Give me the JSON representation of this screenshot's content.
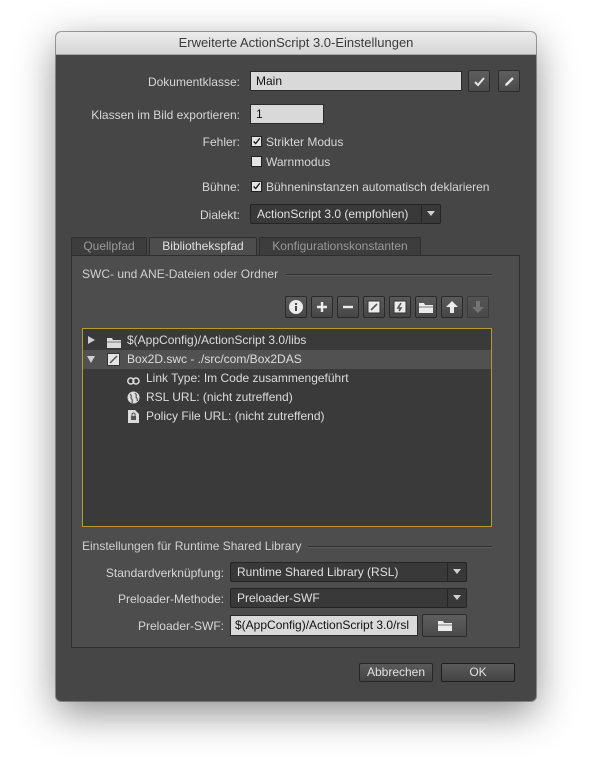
{
  "window": {
    "title": "Erweiterte ActionScript 3.0-Einstellungen"
  },
  "form": {
    "document_class_label": "Dokumentklasse:",
    "document_class_value": "Main",
    "export_frame_label": "Klassen im Bild exportieren:",
    "export_frame_value": "1",
    "errors_label": "Fehler:",
    "strict_mode_label": "Strikter Modus",
    "strict_mode_checked": true,
    "warnings_mode_label": "Warnmodus",
    "warnings_mode_checked": false,
    "stage_label": "Bühne:",
    "stage_auto_declare_label": "Bühneninstanzen automatisch deklarieren",
    "stage_auto_declare_checked": true,
    "dialect_label": "Dialekt:",
    "dialect_value": "ActionScript 3.0 (empfohlen)"
  },
  "tabs": [
    {
      "label": "Quellpfad",
      "active": false
    },
    {
      "label": "Bibliothekspfad",
      "active": true
    },
    {
      "label": "Konfigurationskonstanten",
      "active": false
    }
  ],
  "library": {
    "section_title": "SWC- und ANE-Dateien oder Ordner",
    "toolbar": [
      "info-icon",
      "add-icon",
      "remove-icon",
      "swc-file-icon",
      "flex-sdk-icon",
      "folder-icon",
      "arrow-up-icon",
      "arrow-down-icon"
    ],
    "tree": [
      {
        "label": "$(AppConfig)/ActionScript 3.0/libs",
        "expanded": false
      },
      {
        "label": "Box2D.swc - ./src/com/Box2DAS",
        "expanded": true
      },
      {
        "label": "Link Type: Im Code zusammengeführt"
      },
      {
        "label": "RSL URL: (nicht zutreffend)"
      },
      {
        "label": "Policy File URL: (nicht zutreffend)"
      }
    ]
  },
  "rsl": {
    "section_title": "Einstellungen für Runtime Shared Library",
    "default_linkage_label": "Standardverknüpfung:",
    "default_linkage_value": "Runtime Shared Library (RSL)",
    "preloader_method_label": "Preloader-Methode:",
    "preloader_method_value": "Preloader-SWF",
    "preloader_swf_label": "Preloader-SWF:",
    "preloader_swf_value": "$(AppConfig)/ActionScript 3.0/rsl"
  },
  "buttons": {
    "cancel": "Abbrechen",
    "ok": "OK"
  }
}
